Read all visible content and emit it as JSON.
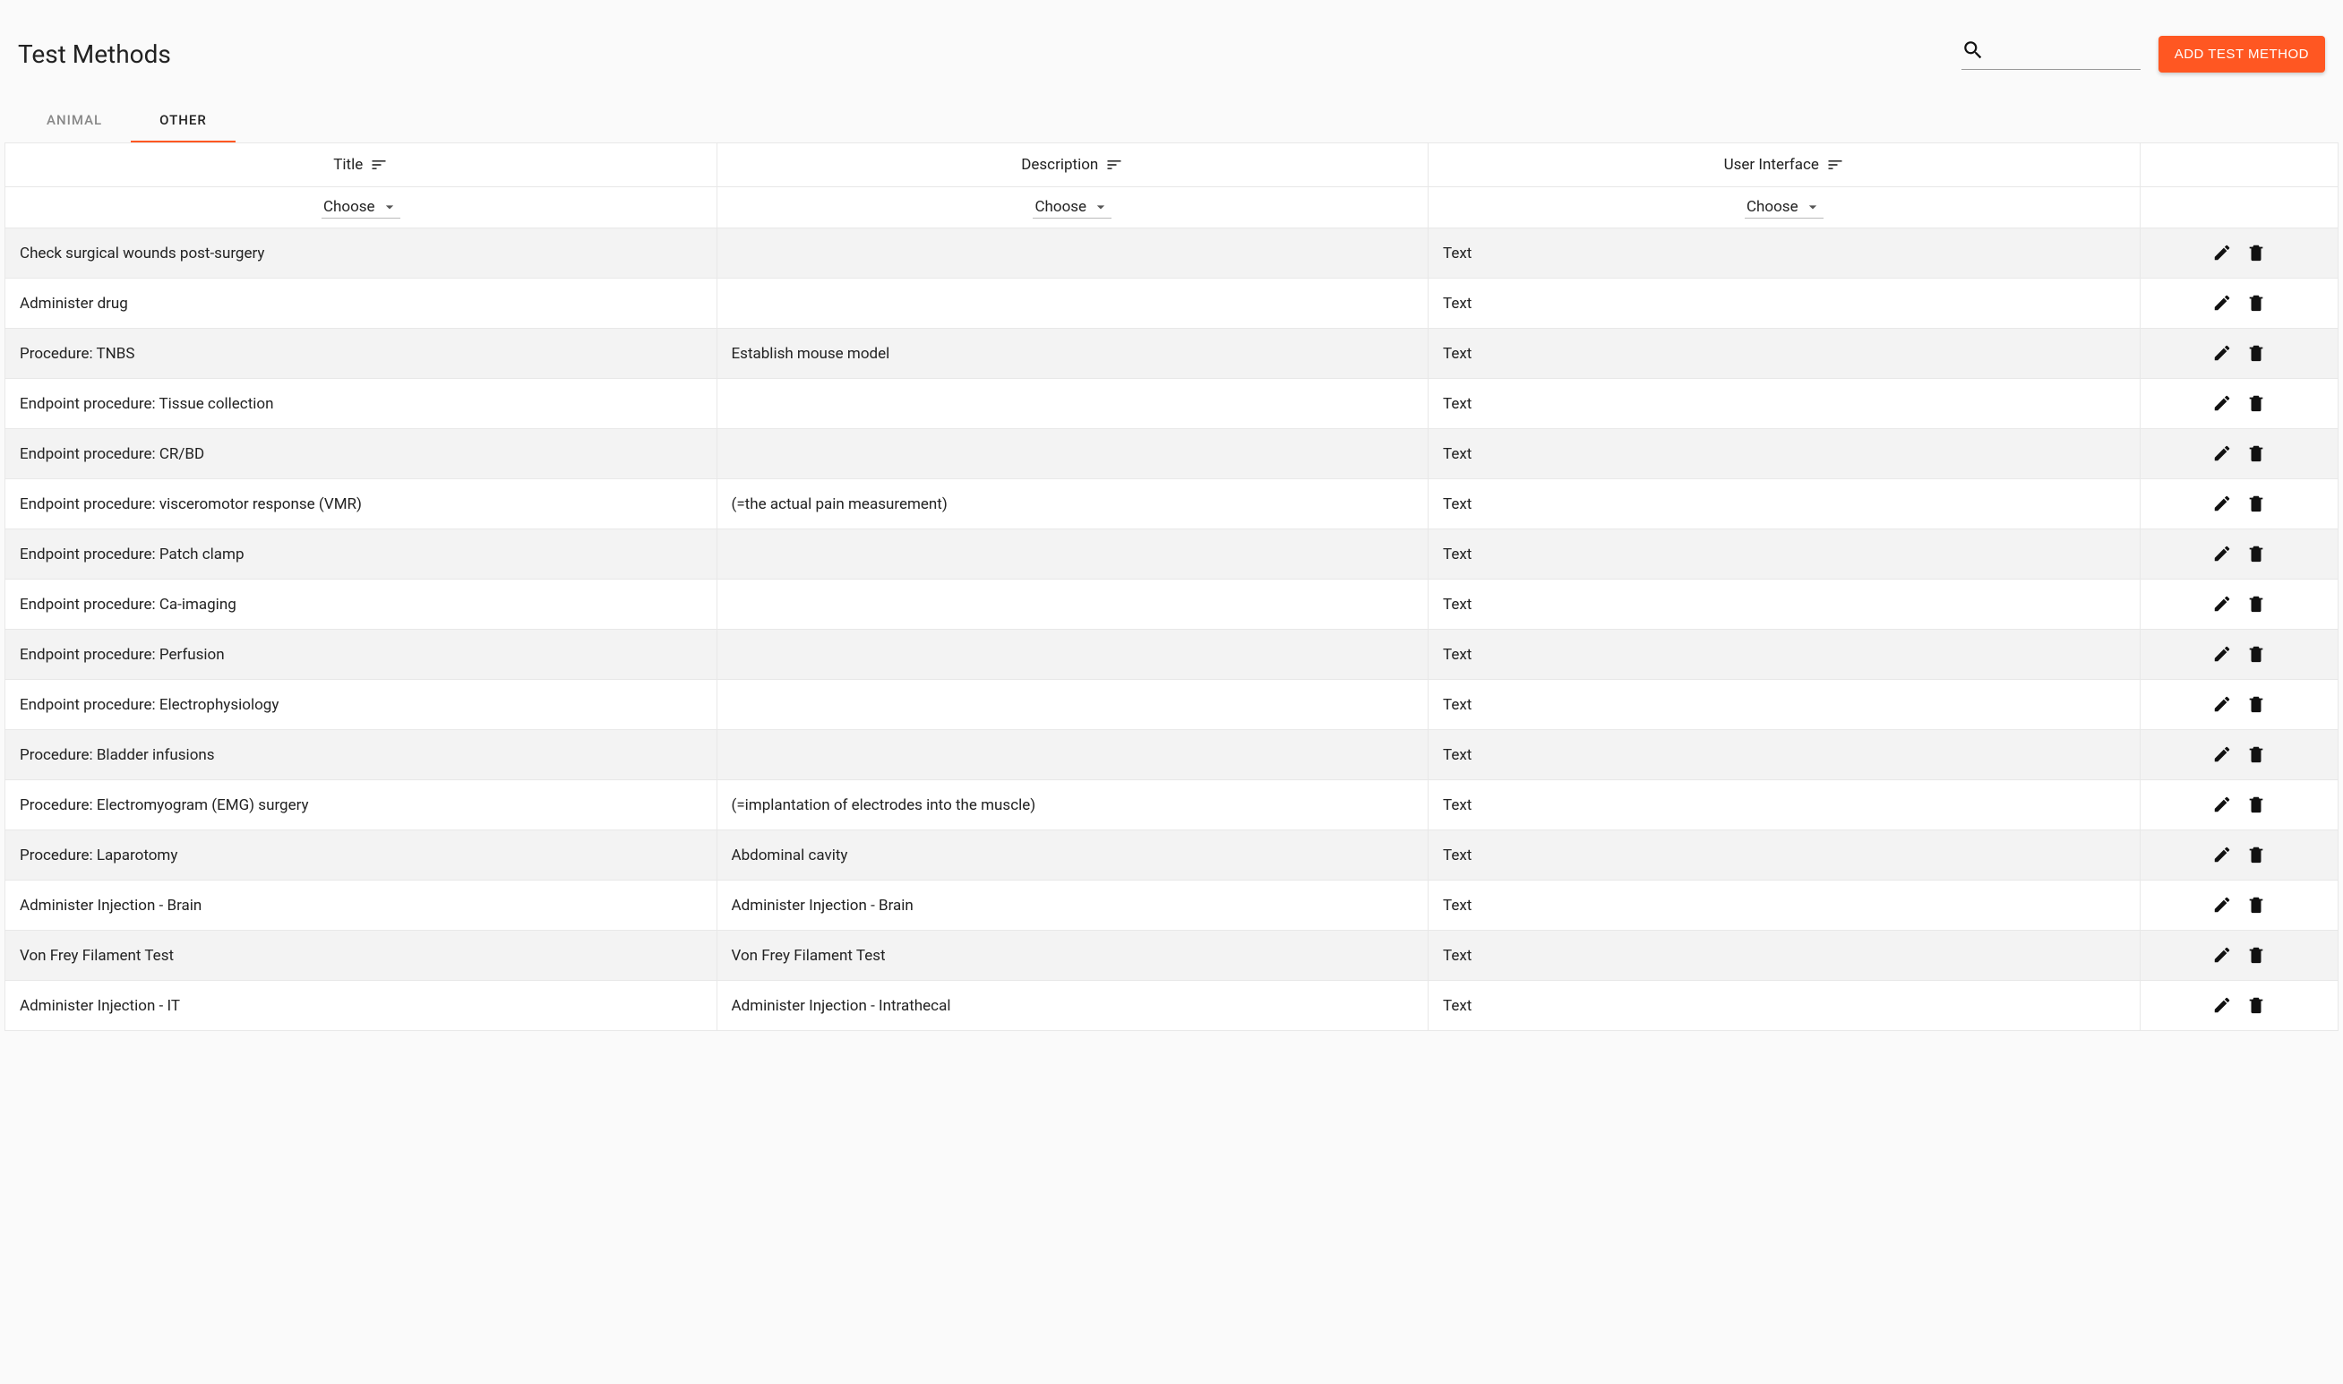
{
  "header": {
    "title": "Test Methods",
    "search_placeholder": "",
    "add_button_label": "ADD TEST METHOD"
  },
  "tabs": [
    {
      "label": "ANIMAL",
      "active": false
    },
    {
      "label": "OTHER",
      "active": true
    }
  ],
  "columns": {
    "title": "Title",
    "description": "Description",
    "user_interface": "User Interface",
    "choose_label": "Choose"
  },
  "rows": [
    {
      "title": "Check surgical wounds post-surgery",
      "description": "",
      "ui": "Text"
    },
    {
      "title": "Administer drug",
      "description": "",
      "ui": "Text"
    },
    {
      "title": "Procedure: TNBS",
      "description": "Establish mouse model",
      "ui": "Text"
    },
    {
      "title": "Endpoint procedure: Tissue collection",
      "description": "",
      "ui": "Text"
    },
    {
      "title": "Endpoint procedure: CR/BD",
      "description": "",
      "ui": "Text"
    },
    {
      "title": "Endpoint procedure: visceromotor response (VMR)",
      "description": "(=the actual pain measurement)",
      "ui": "Text"
    },
    {
      "title": "Endpoint procedure: Patch clamp",
      "description": "",
      "ui": "Text"
    },
    {
      "title": "Endpoint procedure: Ca-imaging",
      "description": "",
      "ui": "Text"
    },
    {
      "title": "Endpoint procedure: Perfusion",
      "description": "",
      "ui": "Text"
    },
    {
      "title": "Endpoint procedure: Electrophysiology",
      "description": "",
      "ui": "Text"
    },
    {
      "title": "Procedure: Bladder infusions",
      "description": "",
      "ui": "Text"
    },
    {
      "title": "Procedure: Electromyogram (EMG) surgery",
      "description": "(=implantation of electrodes into the muscle)",
      "ui": "Text"
    },
    {
      "title": "Procedure: Laparotomy",
      "description": "Abdominal cavity",
      "ui": "Text"
    },
    {
      "title": "Administer Injection - Brain",
      "description": "Administer Injection - Brain",
      "ui": "Text"
    },
    {
      "title": "Von Frey Filament Test",
      "description": "Von Frey Filament Test",
      "ui": "Text"
    },
    {
      "title": "Administer Injection - IT",
      "description": "Administer Injection - Intrathecal",
      "ui": "Text"
    }
  ]
}
